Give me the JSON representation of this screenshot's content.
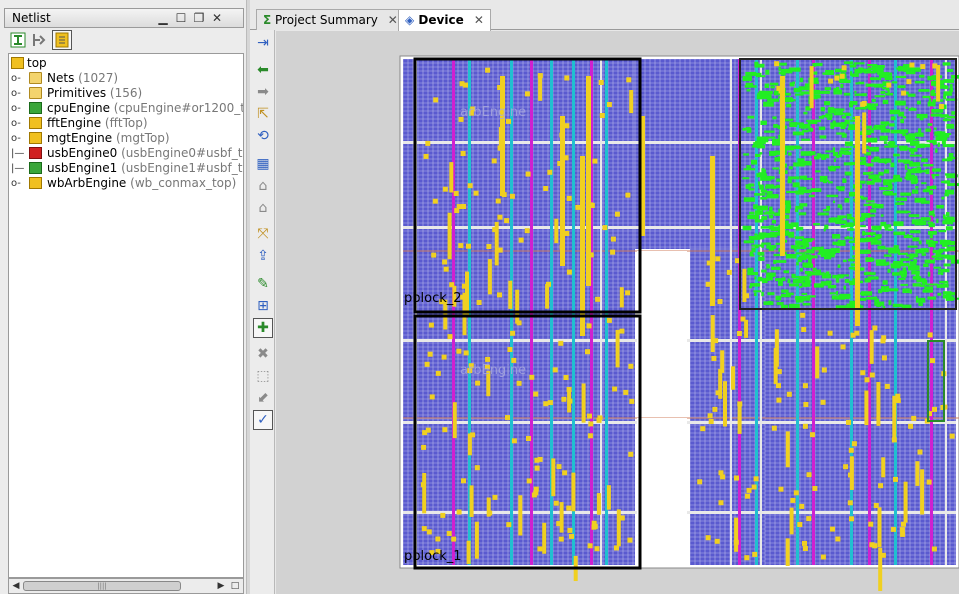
{
  "netlist": {
    "title": "Netlist",
    "toolbar": [
      {
        "name": "collapse-all-icon"
      },
      {
        "name": "expand-icon"
      },
      {
        "name": "show-hierarchy-icon",
        "active": true
      }
    ],
    "tree": [
      {
        "label": "top",
        "detail": "",
        "icon": "top",
        "level": 0,
        "expander": ""
      },
      {
        "label": "Nets",
        "detail": "(1027)",
        "icon": "folder",
        "level": 1,
        "expander": "+"
      },
      {
        "label": "Primitives",
        "detail": "(156)",
        "icon": "folder",
        "level": 1,
        "expander": "+"
      },
      {
        "label": "cpuEngine",
        "detail": "(cpuEngine#or1200_to",
        "icon": "green",
        "level": 1,
        "expander": "+"
      },
      {
        "label": "fftEngine",
        "detail": "(fftTop)",
        "icon": "yellow",
        "level": 1,
        "expander": "+"
      },
      {
        "label": "mgtEngine",
        "detail": "(mgtTop)",
        "icon": "yellow",
        "level": 1,
        "expander": "+"
      },
      {
        "label": "usbEngine0",
        "detail": "(usbEngine0#usbf_top",
        "icon": "red",
        "level": 1,
        "expander": "|"
      },
      {
        "label": "usbEngine1",
        "detail": "(usbEngine1#usbf_top",
        "icon": "green",
        "level": 1,
        "expander": "|"
      },
      {
        "label": "wbArbEngine",
        "detail": "(wb_conmax_top)",
        "icon": "yellow",
        "level": 1,
        "expander": "+"
      }
    ]
  },
  "tabs": [
    {
      "label": "Project Summary",
      "icon": "sigma-icon",
      "active": false
    },
    {
      "label": "Device",
      "icon": "device-icon",
      "active": true
    }
  ],
  "device_toolbar": [
    {
      "name": "select-area-icon",
      "color": "#3060c0"
    },
    {
      "name": "back-arrow-icon",
      "color": "#2a8a2a"
    },
    {
      "name": "forward-arrow-icon",
      "color": "#8a8a8a"
    },
    {
      "name": "select-tool-icon",
      "color": "#c09020"
    },
    {
      "name": "rotate-icon",
      "color": "#3060c0"
    },
    {
      "name": "add-pblock-icon",
      "color": "#3060c0"
    },
    {
      "name": "house-icon",
      "color": "#8a8a8a"
    },
    {
      "name": "house-alt-icon",
      "color": "#8a8a8a"
    },
    {
      "name": "fit-view-icon",
      "color": "#c09020"
    },
    {
      "name": "move-up-icon",
      "color": "#3060c0"
    },
    {
      "name": "route-icon",
      "color": "#2a8a2a"
    },
    {
      "name": "place-icon",
      "color": "#3060c0"
    },
    {
      "name": "highlight-icon",
      "color": "#2a8a2a",
      "active": true
    },
    {
      "name": "pin-icon",
      "color": "#8a8a8a"
    },
    {
      "name": "unplace-icon",
      "color": "#8a8a8a"
    },
    {
      "name": "unroute-icon",
      "color": "#8a8a8a"
    },
    {
      "name": "show-routes-icon",
      "color": "#3060c0",
      "active": true
    }
  ],
  "device": {
    "pblocks": [
      {
        "label": "pblock_2"
      },
      {
        "label": "pblock_1"
      }
    ],
    "ghost_labels": [
      "arbEngine",
      "arbEngine"
    ],
    "colors": {
      "fabric": "#5a5acf",
      "background": "#d2d2d2",
      "cell": "#f0d020",
      "route": "#22ee22",
      "pblock": "#000000",
      "magenta": "#d020d0",
      "cyan": "#20c0d0"
    }
  }
}
